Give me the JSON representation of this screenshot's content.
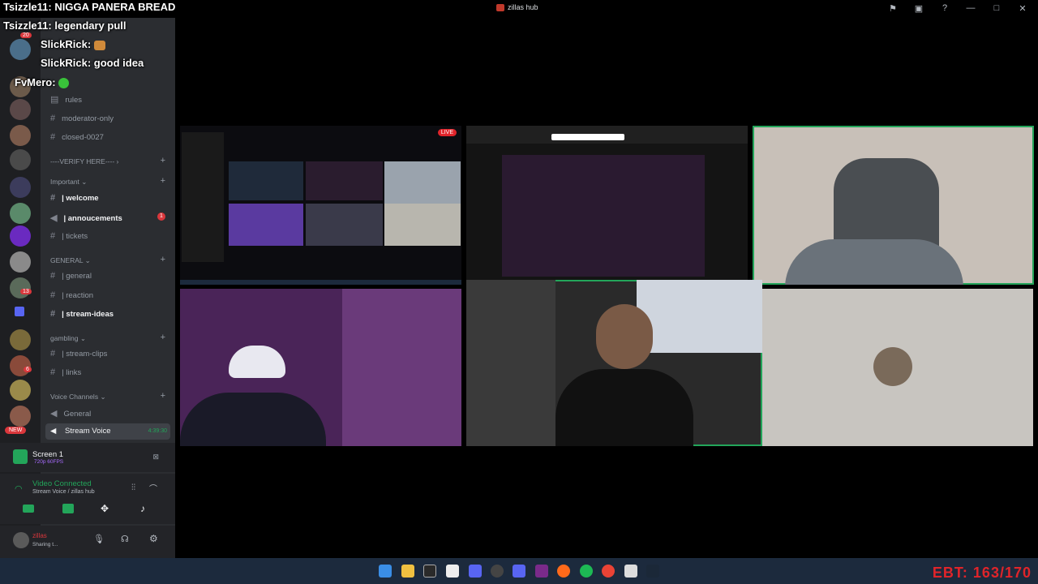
{
  "window": {
    "title": "zillas hub"
  },
  "chat_overlay": [
    {
      "user": "Tsizzle11",
      "message": "NIGGA PANERA BREAD"
    },
    {
      "user": "Tsizzle11",
      "message": "legendary pull"
    },
    {
      "user": "SlickRick",
      "message": ""
    },
    {
      "user": "SlickRick",
      "message": "good idea"
    },
    {
      "user": "FvMero",
      "message": ""
    }
  ],
  "channels": {
    "rules": "rules",
    "moderator_only": "moderator-only",
    "closed": "closed-0027",
    "verify": "----VERIFY HERE----",
    "cat_important": "Important",
    "welcome": "| welcome",
    "annoucements": "| annoucements",
    "annoucements_badge": "1",
    "tickets": "| tickets",
    "cat_general": "GENERAL",
    "general": "| general",
    "reaction": "| reaction",
    "stream_ideas": "| stream-ideas",
    "cat_gambling": "gambling",
    "stream_clips": "| stream-clips",
    "links": "| links",
    "cat_voice": "Voice Channels",
    "voice_general": "General",
    "stream_voice": "Stream Voice",
    "stream_voice_time": "4:39:30"
  },
  "server_badges": {
    "b1": "20",
    "b2": "13",
    "b3": "6",
    "new": "NEW"
  },
  "screen_share": {
    "title": "Screen 1",
    "sub": "720p 60FPS"
  },
  "voice_status": {
    "title": "Video Connected",
    "sub": "Stream Voice / zillas hub"
  },
  "user": {
    "name": "zillas",
    "status": "Sharing t..."
  },
  "stream_tiles": {
    "live_badge": "LIVE"
  },
  "overlay": {
    "ebt": "EBT: 163/170"
  },
  "colors": {
    "accent_green": "#23a55a",
    "overlay_red": "#e0242a",
    "mention_red": "#da373c"
  }
}
